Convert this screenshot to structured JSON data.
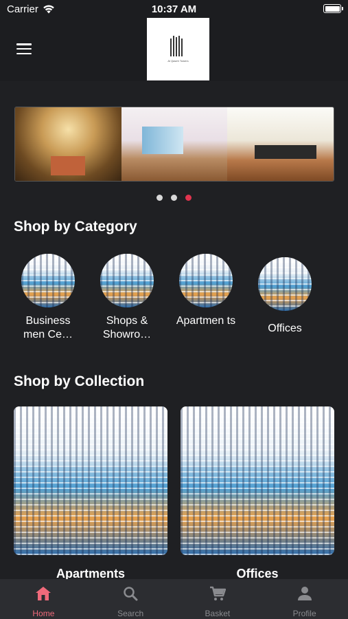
{
  "status_bar": {
    "carrier": "Carrier",
    "time": "10:37 AM"
  },
  "header": {
    "logo_text": "Al Qaseh Towers"
  },
  "banner": {
    "active_index": 2,
    "slide_count": 3
  },
  "categories": {
    "title": "Shop by Category",
    "items": [
      {
        "label": "Business men Ce…"
      },
      {
        "label": "Shops & Showro…"
      },
      {
        "label": "Apartmen ts"
      },
      {
        "label": "Offices"
      }
    ]
  },
  "collections": {
    "title": "Shop by Collection",
    "items": [
      {
        "label": "Apartments"
      },
      {
        "label": "Offices"
      }
    ]
  },
  "tab_bar": {
    "active": "home",
    "accent_color": "#f06a7b",
    "items": [
      {
        "label": "Home",
        "icon": "home-icon"
      },
      {
        "label": "Search",
        "icon": "search-icon"
      },
      {
        "label": "Basket",
        "icon": "cart-icon"
      },
      {
        "label": "Profile",
        "icon": "profile-icon"
      }
    ]
  }
}
